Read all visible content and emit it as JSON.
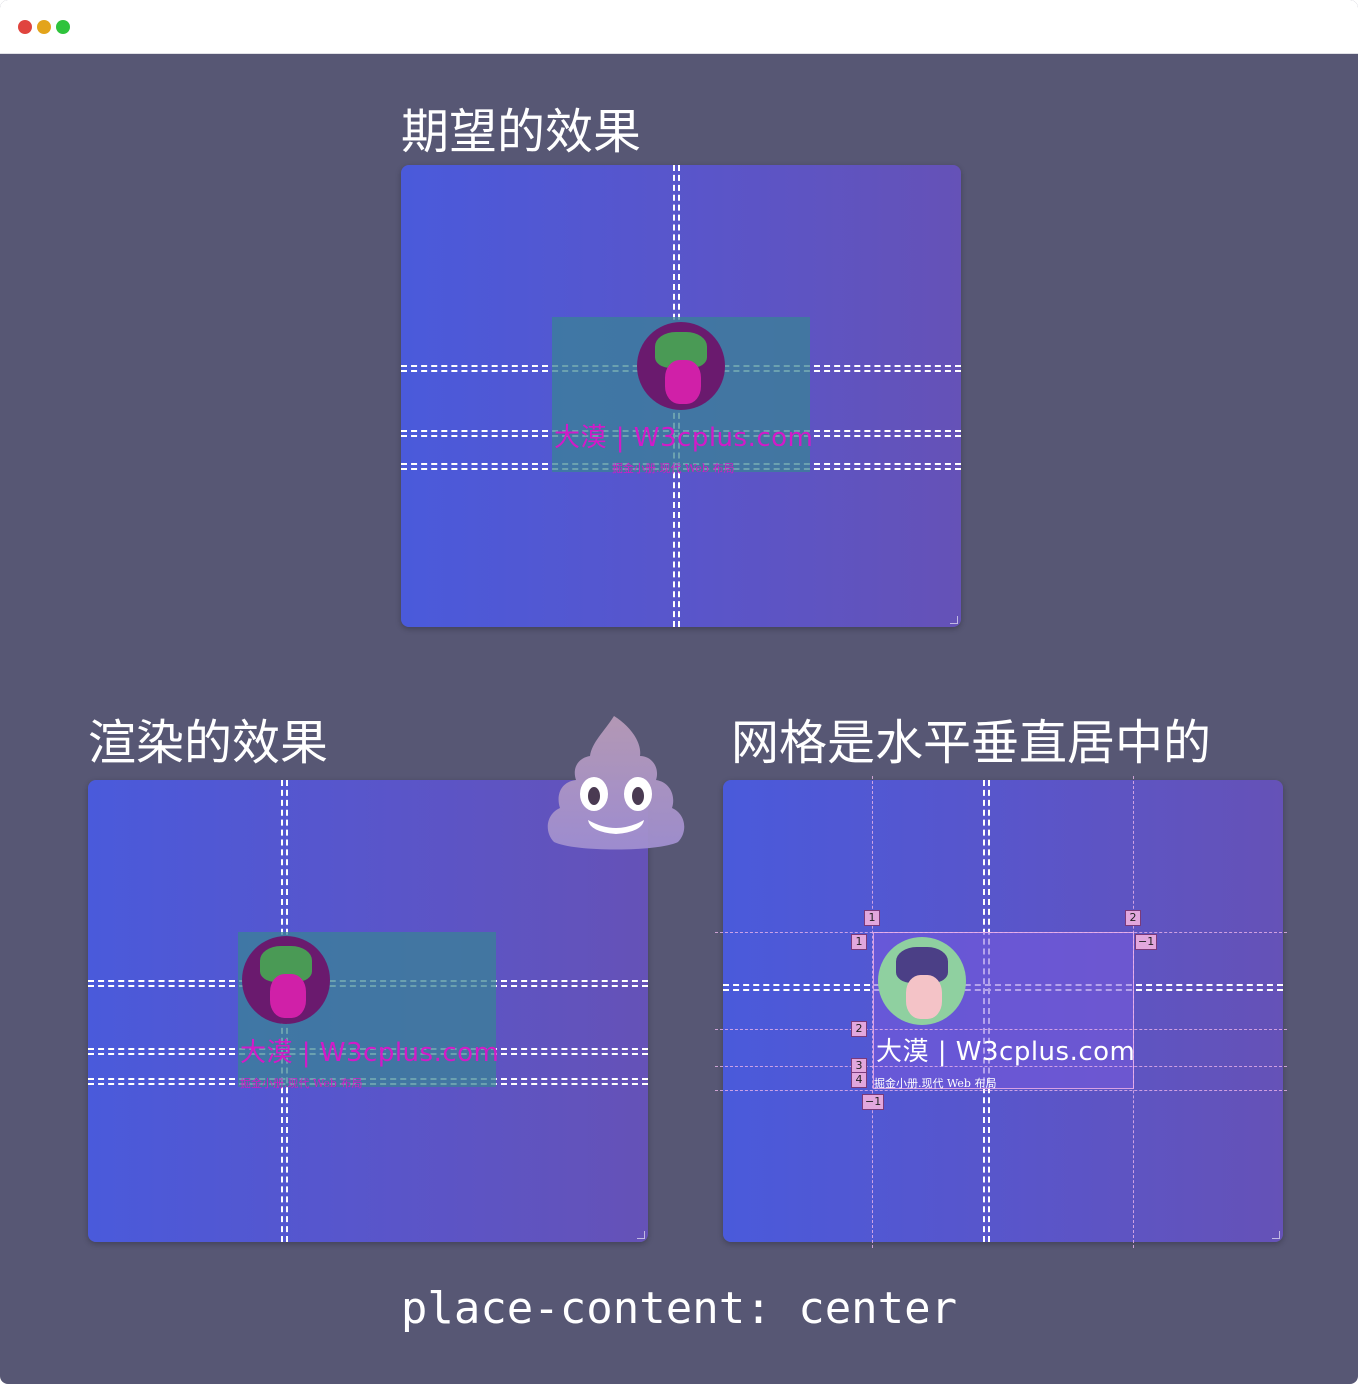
{
  "window": {
    "controls": [
      "close",
      "minimize",
      "maximize"
    ]
  },
  "headings": {
    "expected": "期望的效果",
    "rendered": "渲染的效果",
    "grid_centered": "网格是水平垂直居中的"
  },
  "card": {
    "brand": "大漠 | W3cplus.com",
    "tagline": "掘金小册.现代 Web 布局"
  },
  "grid_badges": {
    "col_top_1": "1",
    "col_top_2": "2",
    "row_left_1": "1",
    "row_right_neg1": "−1",
    "row_left_2": "2",
    "row_left_3": "3",
    "row_left_4": "4",
    "row_bottom_neg1": "−1"
  },
  "emoji": {
    "name": "pile-of-poo-emoji"
  },
  "code_caption": "place-content: center",
  "colors": {
    "background": "#575774",
    "panel_gradient_start": "#4a5adb",
    "panel_gradient_end": "#6552b7",
    "brand_magenta": "#d21ac8",
    "grid_badge": "#e2a7dd"
  }
}
